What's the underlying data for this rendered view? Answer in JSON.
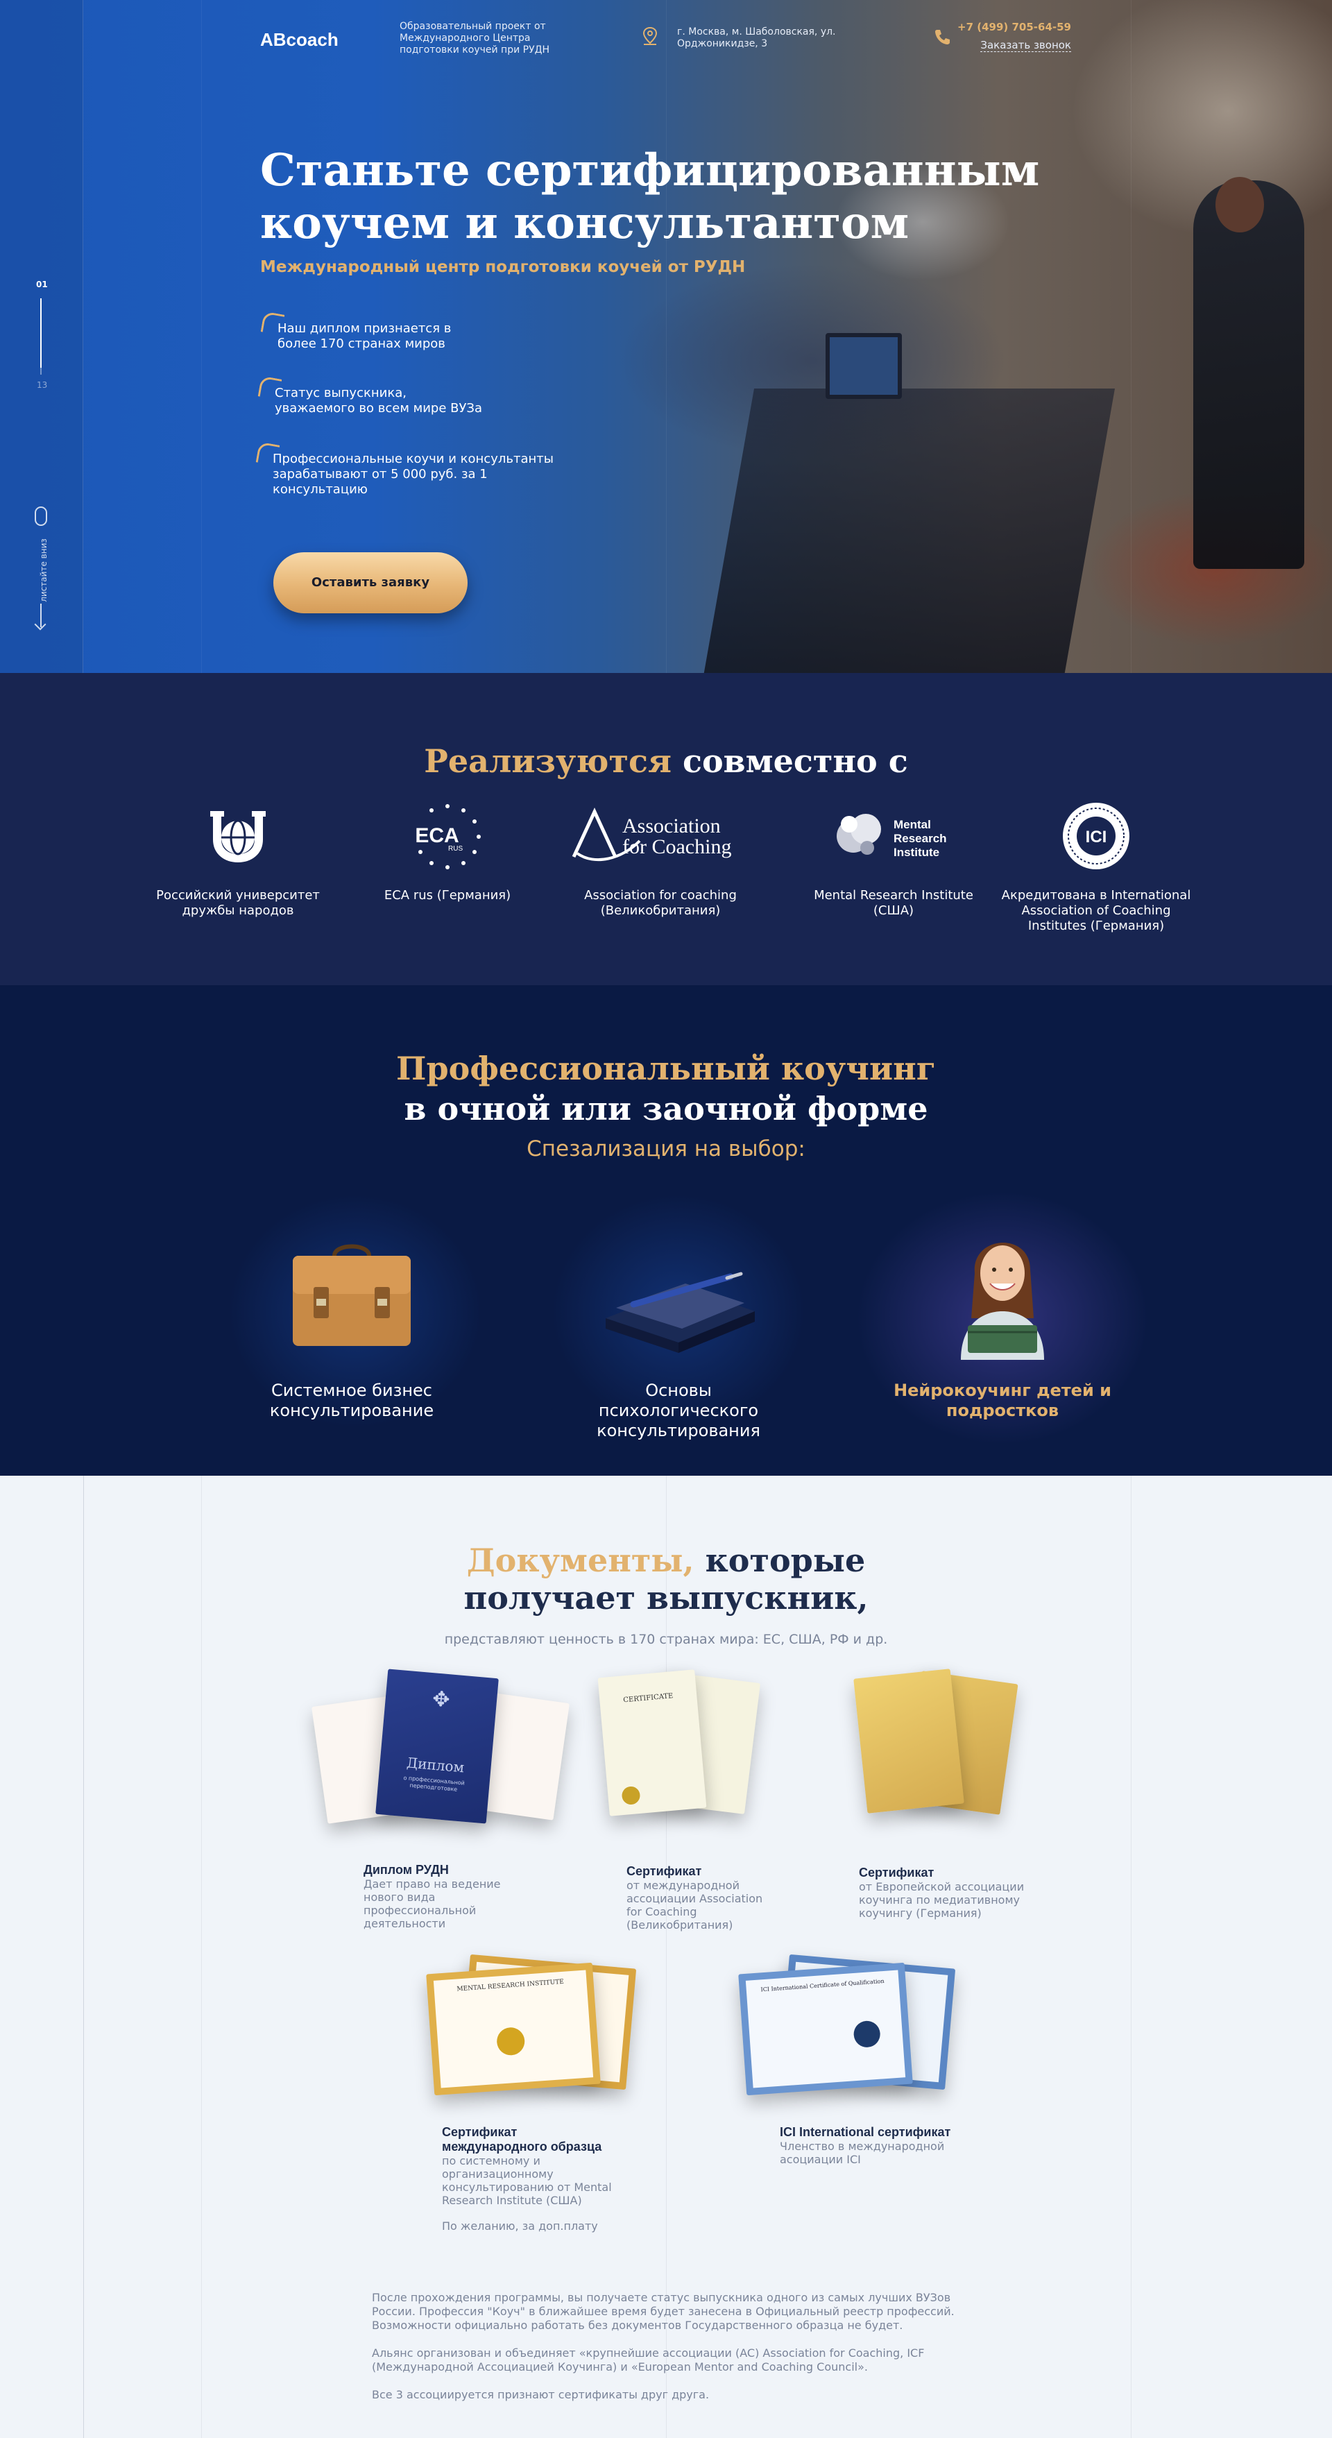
{
  "header": {
    "brand": "ABcoach",
    "brand_desc": "Образовательный проект от Международного Центра подготовки коучей при РУДН",
    "address": "г. Москва, м. Шаболовская, ул. Орджоникидзе, 3",
    "phone": "+7 (499) 705-64-59",
    "callback": "Заказать звонок"
  },
  "hero": {
    "title_line1": "Станьте сертифицированным",
    "title_line2": "коучем и консультантом",
    "subtitle": "Международный центр подготовки коучей  от РУДН",
    "bullets": [
      "Наш диплом признается в более 170 странах миров",
      "Статус выпускника, уважаемого во всем мире ВУЗа",
      "Профессиональные коучи и консультанты зарабатывают от 5 000 руб. за 1 консультацию"
    ],
    "cta": "Оставить заявку",
    "slide_current": "01",
    "slide_total": "13",
    "scroll_hint": "листайте вниз"
  },
  "partners": {
    "title_gold": "Реализуются",
    "title_white": "совместно с",
    "items": [
      {
        "name": "Российский университет дружбы народов"
      },
      {
        "name": "ECA rus (Германия)",
        "logo_text": "ECA",
        "logo_sub": "RUS"
      },
      {
        "name": "Association for coaching (Великобритания)",
        "logo_text": "Association for Coaching"
      },
      {
        "name": "Mental Research Institute (США)",
        "logo_text": "Mental Research Institute"
      },
      {
        "name": "Акредитована в International Association of Coaching Institutes (Германия)",
        "logo_text": "ICI"
      }
    ]
  },
  "coaching": {
    "title_line1": "Профессиональный коучинг",
    "title_line2": "в очной или заочной форме",
    "subtitle": "Спезализация на выбор:",
    "specs": [
      {
        "label": "Системное бизнес консультирование"
      },
      {
        "label": "Основы психологического консультирования"
      },
      {
        "label": "Нейрокоучинг детей и подростков"
      }
    ]
  },
  "documents": {
    "title_gold": "Документы,",
    "title_dark_1": "которые",
    "title_dark_2": "получает выпускник,",
    "subtitle": "представляют ценность в 170 странах мира: ЕС, США,  РФ и др.",
    "items": [
      {
        "title": "Диплом РУДН",
        "desc": "Дает право на ведение нового вида профессиональной деятельности",
        "cover_text": "Диплом",
        "cover_sub": "о профессиональной переподготовке"
      },
      {
        "title": "Сертификат",
        "desc": "от международной ассоциации Association for Coaching (Великобритания)",
        "paper_heading": "CERTIFICATE"
      },
      {
        "title": "Сертификат",
        "desc": "от Европейской ассоциации коучинга по медиативному коучингу (Германия)"
      },
      {
        "title": "Сертификат международного образца",
        "desc": "по системному и организационному консультированию от Mental Research Institute (США)",
        "note": "По желанию, за доп.плату",
        "paper_heading": "MENTAL RESEARCH INSTITUTE"
      },
      {
        "title": "ICI International сертификат",
        "desc": "Членство в международной асоциации ICI",
        "paper_heading": "ICI International Certificate of Qualification"
      }
    ],
    "footer_p1": "После прохождения программы, вы получаете статус выпускника одного из самых лучших ВУЗов России. Профессия \"Коуч\" в ближайшее время будет занесена в Официальный реестр профессий. Возможности официально работать без документов Государственного образца не будет.",
    "footer_p2": "Альянс организован и объединяет «крупнейшие ассоциации (AC) Association for Coaching, ICF (Международной Ассоциацией Коучинга) и «European Mentor and Coaching Council».",
    "footer_p3": "Все 3 ассоциируется признают сертификаты друг друга."
  },
  "colors": {
    "gold": "#e2b26e",
    "navy": "#182551",
    "deep_navy": "#0a1a44",
    "light_bg": "#f0f4f9",
    "dark_text": "#1e2c4c"
  }
}
